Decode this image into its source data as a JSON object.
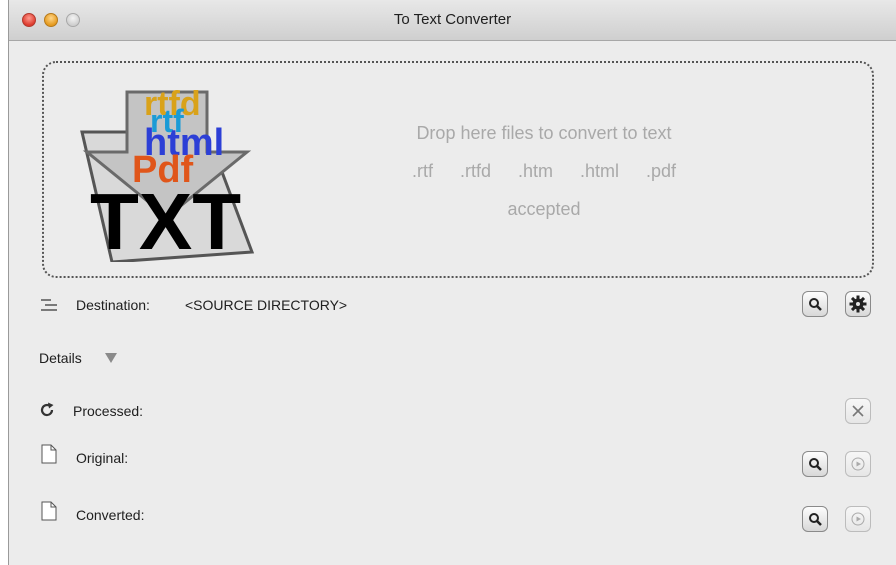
{
  "window": {
    "title": "To Text Converter"
  },
  "dropzone": {
    "line1": "Drop here files to convert to text",
    "line2": ".rtf   .rtfd   .htm   .html   .pdf",
    "line3": "accepted",
    "icon_words": [
      "rtfd",
      "rtf",
      "html",
      "Pdf",
      "TXT"
    ],
    "icon_colors": {
      "rtfd": "#d9a21a",
      "rtf": "#1a9bd6",
      "html": "#2c3fd6",
      "Pdf": "#e0561a",
      "TXT": "#000000"
    }
  },
  "destination": {
    "label": "Destination:",
    "value": "<SOURCE DIRECTORY>"
  },
  "details": {
    "label": "Details"
  },
  "rows": {
    "processed": "Processed:",
    "original": "Original:",
    "converted": "Converted:"
  },
  "icons": {
    "destination_icon": "list-lines-icon",
    "settings": "gear-icon",
    "reveal": "magnifier-icon",
    "clear": "close-x-icon",
    "open": "play-icon",
    "refresh": "refresh-icon",
    "document": "document-icon"
  }
}
